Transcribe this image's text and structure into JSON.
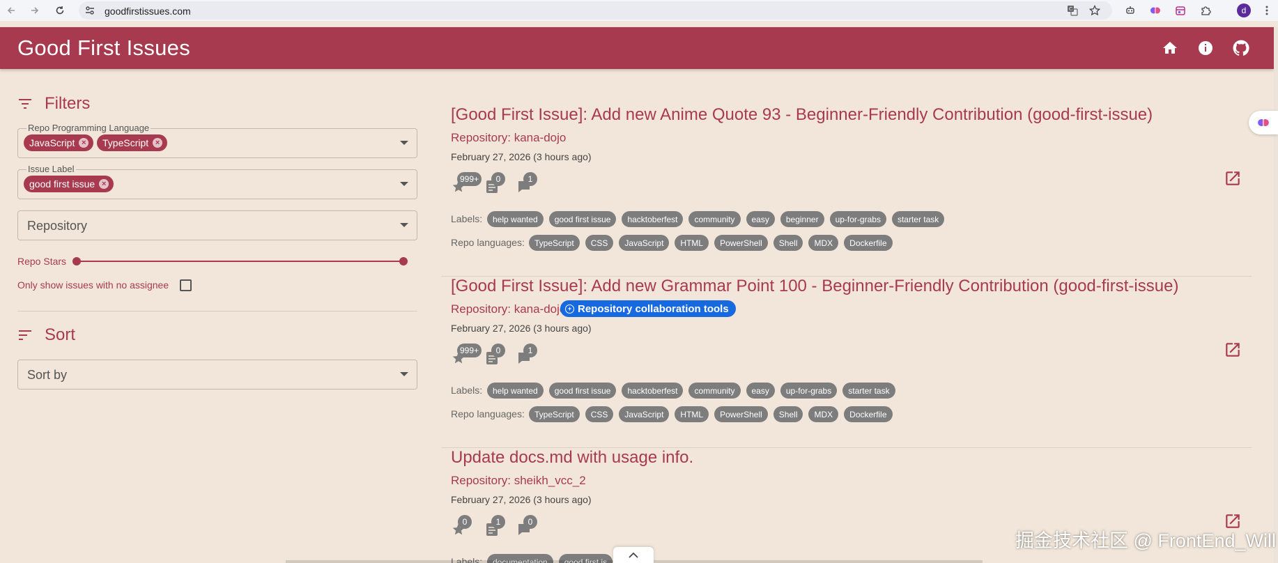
{
  "browser": {
    "url": "goodfirstissues.com",
    "profile_initial": "d"
  },
  "app": {
    "title": "Good First Issues"
  },
  "filters": {
    "title": "Filters",
    "language_field": {
      "legend": "Repo Programming Language",
      "chips": [
        "JavaScript",
        "TypeScript"
      ]
    },
    "label_field": {
      "legend": "Issue Label",
      "chips": [
        "good first issue"
      ]
    },
    "repository_field": {
      "placeholder": "Repository"
    },
    "stars_label": "Repo Stars",
    "assignee_label": "Only show issues with no assignee"
  },
  "sort": {
    "title": "Sort",
    "sort_field": {
      "placeholder": "Sort by"
    }
  },
  "issues": [
    {
      "title": "[Good First Issue]: Add new Anime Quote 93 - Beginner-Friendly Contribution (good-first-issue)",
      "repo": "Repository: kana-dojo",
      "date": "February 27, 2026 (3 hours ago)",
      "stars": "999+",
      "prs": "0",
      "comments": "1",
      "labels_title": "Labels:",
      "labels": [
        "help wanted",
        "good first issue",
        "hacktoberfest",
        "community",
        "easy",
        "beginner",
        "up-for-grabs",
        "starter task"
      ],
      "languages_title": "Repo languages:",
      "languages": [
        "TypeScript",
        "CSS",
        "JavaScript",
        "HTML",
        "PowerShell",
        "Shell",
        "MDX",
        "Dockerfile"
      ]
    },
    {
      "title": "[Good First Issue]: Add new Grammar Point 100 - Beginner-Friendly Contribution (good-first-issue)",
      "repo": "Repository: kana-dojo",
      "date": "February 27, 2026 (3 hours ago)",
      "stars": "999+",
      "prs": "0",
      "comments": "1",
      "labels_title": "Labels:",
      "labels": [
        "help wanted",
        "good first issue",
        "hacktoberfest",
        "community",
        "easy",
        "up-for-grabs",
        "starter task"
      ],
      "languages_title": "Repo languages:",
      "languages": [
        "TypeScript",
        "CSS",
        "JavaScript",
        "HTML",
        "PowerShell",
        "Shell",
        "MDX",
        "Dockerfile"
      ]
    },
    {
      "title": "Update docs.md with usage info.",
      "repo": "Repository: sheikh_vcc_2",
      "date": "February 27, 2026 (3 hours ago)",
      "stars": "0",
      "prs": "1",
      "comments": "0",
      "labels_title": "Labels:",
      "labels": [
        "documentation",
        "good first is"
      ]
    }
  ],
  "tooltip": "Repository collaboration tools",
  "watermark": "掘金技术社区 @ FrontEnd_Will",
  "colors": {
    "brand": "#a83a4f",
    "background": "#f1e6d9",
    "tag": "#7d7d7d",
    "tooltip": "#1769e0"
  }
}
